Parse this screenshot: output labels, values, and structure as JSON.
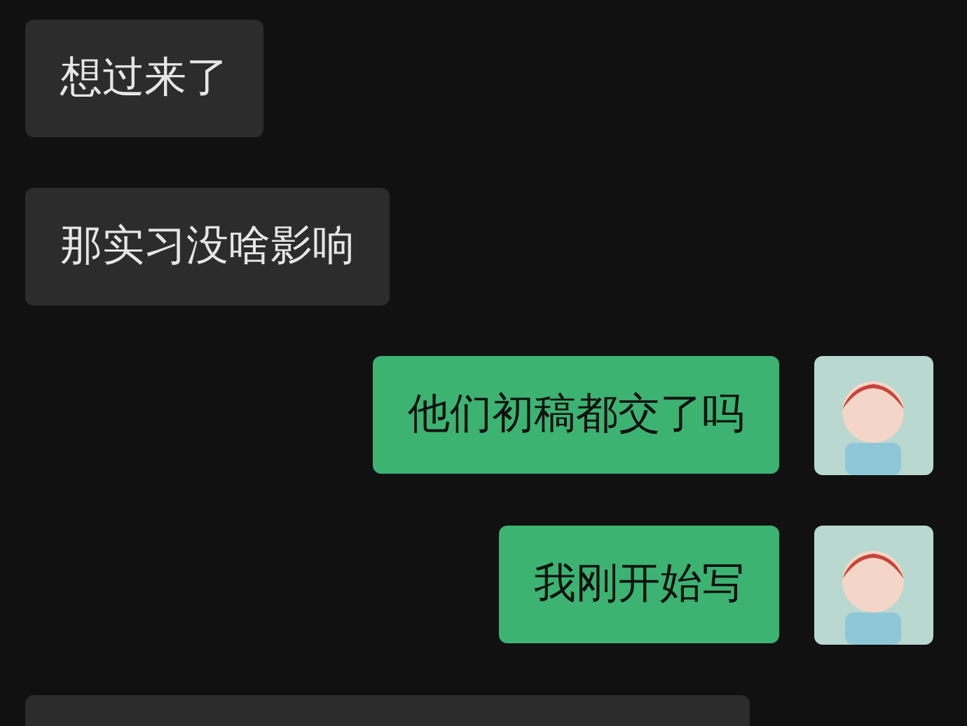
{
  "messages": [
    {
      "kind": "incoming",
      "text": "想过来了"
    },
    {
      "kind": "incoming",
      "text": "那实习没啥影响"
    },
    {
      "kind": "outgoing",
      "text": "他们初稿都交了吗"
    },
    {
      "kind": "outgoing",
      "text": "我刚开始写"
    },
    {
      "kind": "incoming"
    }
  ]
}
